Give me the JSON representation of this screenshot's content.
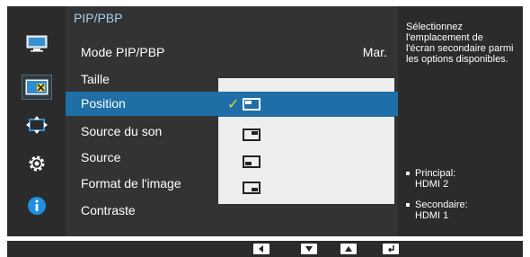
{
  "menu": {
    "title": "PIP/PBP",
    "items": [
      {
        "label": "Mode PIP/PBP",
        "value": "Mar."
      },
      {
        "label": "Taille",
        "value": ""
      },
      {
        "label": "Position",
        "value": ""
      },
      {
        "label": "Source du son",
        "value": ""
      },
      {
        "label": "Source",
        "value": ""
      },
      {
        "label": "Format de l'image",
        "value": ""
      },
      {
        "label": "Contraste",
        "value": ""
      }
    ],
    "selected_index": 2
  },
  "sidebar": {
    "icons": [
      "picture-icon",
      "pip-pbp-icon",
      "onscreen-display-icon",
      "settings-gear-icon",
      "information-icon"
    ],
    "active_index": 1
  },
  "position_popup": {
    "options": [
      "top-left",
      "top-right",
      "bottom-left",
      "bottom-right"
    ],
    "selected_index": 0
  },
  "help": {
    "text": "Sélectionnez l'emplacement de l'écran secondaire parmi les options disponibles.",
    "principal_label": "Principal:",
    "principal_value": "HDMI 2",
    "secondary_label": "Secondaire:",
    "secondary_value": "HDMI 1"
  },
  "bottom_bar": {
    "buttons": [
      "left-arrow-icon",
      "down-arrow-icon",
      "up-arrow-icon",
      "enter-icon"
    ]
  }
}
